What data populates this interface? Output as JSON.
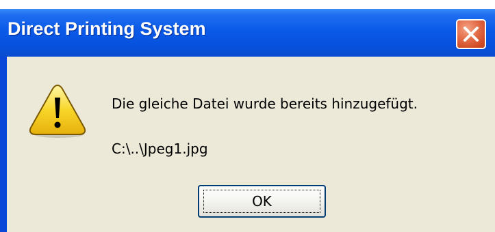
{
  "window": {
    "title": "Direct Printing System",
    "title_color": "#ffffff",
    "titlebar_color": "#0a5ae8",
    "close_icon": "close-icon"
  },
  "dialog": {
    "icon": "warning-icon",
    "message": "Die gleiche Datei wurde bereits hinzugefügt.",
    "file_path": "C:\\..\\Jpeg1.jpg",
    "ok_label": "OK",
    "background_color": "#ece9d8"
  }
}
